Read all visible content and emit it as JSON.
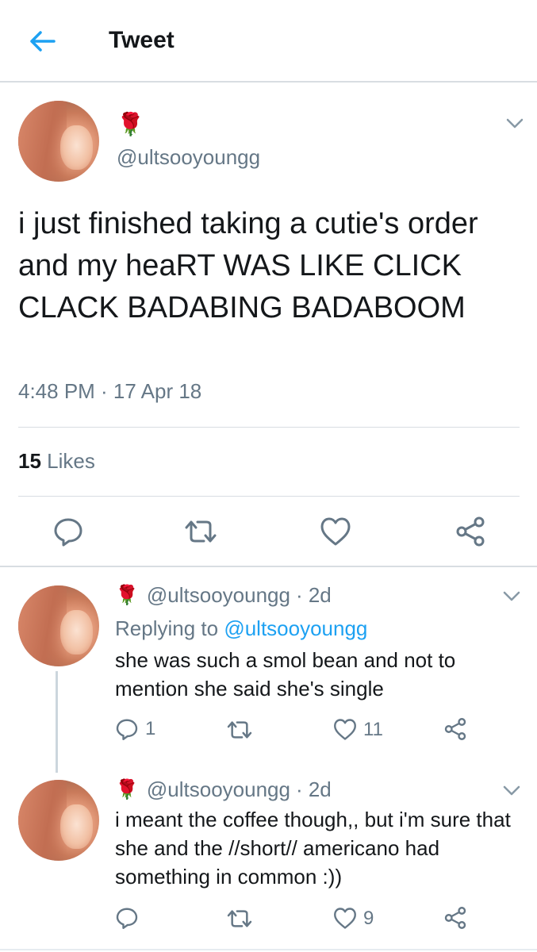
{
  "header": {
    "title": "Tweet",
    "back_icon": "arrow-left-icon"
  },
  "colors": {
    "accent": "#1da1f2",
    "text": "#14171a",
    "muted": "#657786",
    "divider": "#d8dde2",
    "rose": "#d2432a"
  },
  "main_tweet": {
    "display_name": "🌹",
    "handle": "@ultsooyoungg",
    "text": "i just finished taking a cutie's order and my heaRT WAS LIKE CLICK CLACK BADABING BADABOOM",
    "timestamp": "4:48 PM · 17 Apr 18",
    "likes_count": "15",
    "likes_label": "Likes",
    "actions": [
      "reply-icon",
      "retweet-icon",
      "like-icon",
      "share-icon"
    ]
  },
  "replies": [
    {
      "display_name": "🌹",
      "handle": "@ultsooyoungg",
      "age": "· 2d",
      "replying_label": "Replying to",
      "replying_to": "@ultsooyoungg",
      "text": "she was such a smol bean and not to mention she said she's single",
      "reply_count": "1",
      "retweet_count": "",
      "like_count": "11"
    },
    {
      "display_name": "🌹",
      "handle": "@ultsooyoungg",
      "age": "· 2d",
      "text": "i meant the coffee though,, but i'm sure that she and the //short// americano had something in common :))",
      "reply_count": "",
      "retweet_count": "",
      "like_count": "9"
    }
  ]
}
